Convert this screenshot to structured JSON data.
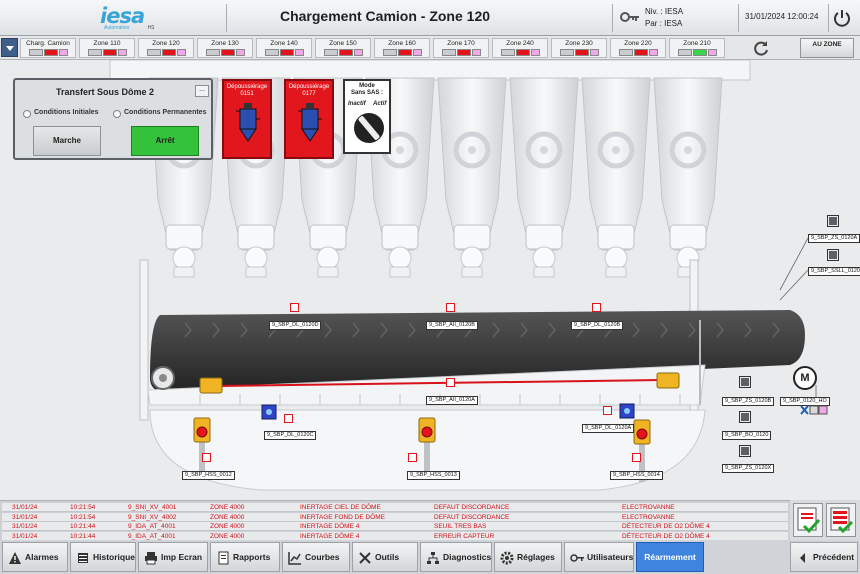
{
  "header": {
    "logo_text": "iesa",
    "logo_sub": "Automation",
    "logo_tag": "H1",
    "title": "Chargement Camion - Zone 120",
    "niv": "Niv. : IESA",
    "par": "Par : IESA",
    "datetime": "31/01/2024 12:00:24"
  },
  "zonebar": {
    "tiles": [
      {
        "label": "Charg. Camion",
        "status": "red"
      },
      {
        "label": "Zone 110",
        "status": "red"
      },
      {
        "label": "Zone 120",
        "status": "red"
      },
      {
        "label": "Zone 130",
        "status": "red"
      },
      {
        "label": "Zone 140",
        "status": "red"
      },
      {
        "label": "Zone 150",
        "status": "red"
      },
      {
        "label": "Zone 160",
        "status": "red"
      },
      {
        "label": "Zone 170",
        "status": "red"
      },
      {
        "label": "Zone 240",
        "status": "red"
      },
      {
        "label": "Zone 230",
        "status": "red"
      },
      {
        "label": "Zone 220",
        "status": "red"
      },
      {
        "label": "Zone 210",
        "status": "green"
      }
    ],
    "au_zone": "AU ZONE"
  },
  "transfert": {
    "title": "Transfert Sous Dôme 2",
    "more": "...",
    "cond_init": "Conditions Initiales",
    "cond_perm": "Conditions Permanentes",
    "marche": "Marche",
    "arret": "Arrêt"
  },
  "depoussierage": [
    {
      "label": "Dépoussiérage",
      "code": "0151"
    },
    {
      "label": "Dépoussiérage",
      "code": "0177"
    }
  ],
  "mode": {
    "title_1": "Mode",
    "title_2": "Sans SAS :",
    "inactif": "Inactif",
    "actif": "Actif"
  },
  "tags": {
    "zs_0120a": "9_SBP_ZS_0120A",
    "ssll_0120": "9_SBP_SSLL_0120",
    "dl_0120d": "9_SBP_DL_0120D",
    "aii_0120b": "9_SBP_AII_0120B",
    "dl_0120b": "9_SBP_DL_0120B",
    "aii_0120a": "9_SBP_AII_0120A",
    "dl_0120c": "9_SBP_DL_0120C",
    "dl_0120a": "9_SBP_DL_0120A",
    "zs_0120b": "9_SBP_ZS_0120B",
    "ho_0120": "9_SBP_0120_HO",
    "bo_0120": "9_SBP_BO_0120",
    "zs_0120x": "9_SBP_ZS_0120X",
    "hss_0012": "9_SBP_HSS_0012",
    "hss_0013": "9_SBP_HSS_0013",
    "hss_0014": "9_SBP_HSS_0014"
  },
  "motor": {
    "label": "M"
  },
  "alarms": [
    {
      "date": "31/01/24",
      "time": "10:21:54",
      "tag": "9_SNI_XV_4001",
      "zone": "ZONE 4000",
      "text": "INERTAGE CIEL DE DÔME",
      "type": "DEFAUT DISCORDANCE",
      "device": "ELECTROVANNE"
    },
    {
      "date": "31/01/24",
      "time": "10:21:54",
      "tag": "9_SNI_XV_4002",
      "zone": "ZONE 4000",
      "text": "INERTAGE FOND DE DÔME",
      "type": "DEFAUT DISCORDANCE",
      "device": "ELECTROVANNE"
    },
    {
      "date": "31/01/24",
      "time": "10:21:44",
      "tag": "9_IDA_AT_4001",
      "zone": "ZONE 4000",
      "text": "INERTAGE DÔME 4",
      "type": "SEUIL TRES BAS",
      "device": "DÉTECTEUR DE O2 DÔME 4"
    },
    {
      "date": "31/01/24",
      "time": "10:21:44",
      "tag": "9_IDA_AT_4001",
      "zone": "ZONE 4000",
      "text": "INERTAGE DÔME 4",
      "type": "ERREUR CAPTEUR",
      "device": "DÉTECTEUR DE O2 DÔME 4"
    }
  ],
  "nav": {
    "alarmes": "Alarmes",
    "historique": "Historique",
    "imp_ecran": "Imp Ecran",
    "rapports": "Rapports",
    "courbes": "Courbes",
    "outils": "Outils",
    "diagnostics": "Diagnostics",
    "reglages": "Réglages",
    "utilisateurs": "Utilisateurs",
    "rearmement": "Réarmement",
    "precedent": "Précédent"
  },
  "colors": {
    "alarm": "#e3141b",
    "ok": "#33c23a",
    "active_nav": "#3f85e0"
  }
}
